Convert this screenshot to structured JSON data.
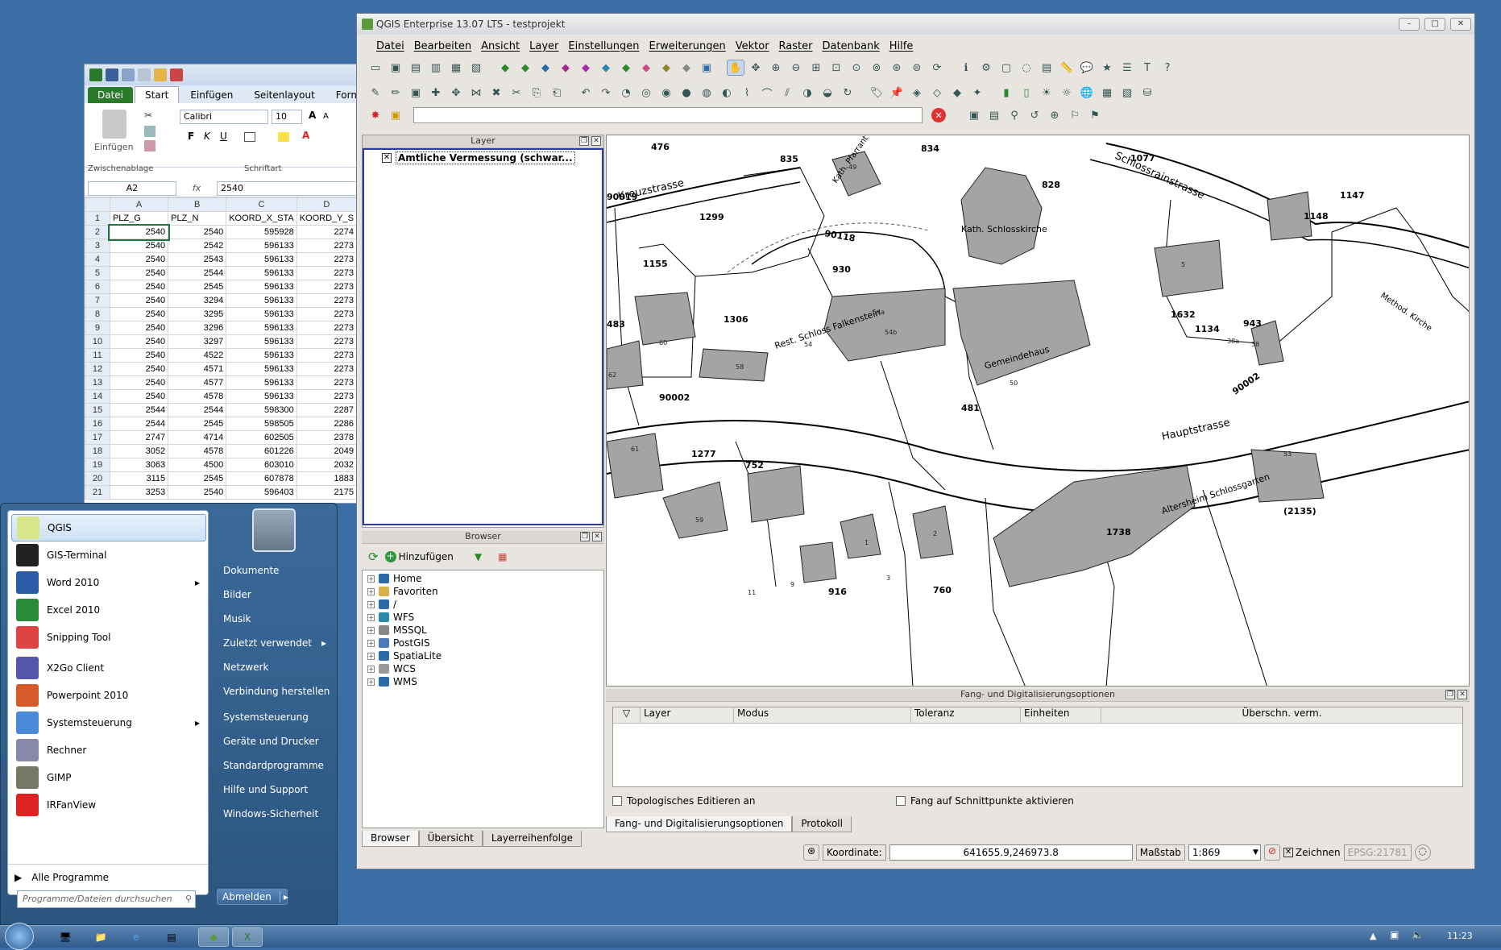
{
  "excel": {
    "tabs": [
      "Datei",
      "Start",
      "Einfügen",
      "Seitenlayout",
      "Formel"
    ],
    "group_labels": [
      "Zwischenablage",
      "Schriftart"
    ],
    "paste_label": "Einfügen",
    "font_name": "Calibri",
    "font_size": "10",
    "name_box": "A2",
    "fx": "fx",
    "formula_value": "2540",
    "col_headers": [
      "",
      "A",
      "B",
      "C",
      "D"
    ],
    "rows": [
      [
        "1",
        "PLZ_G",
        "PLZ_N",
        "KOORD_X_STA",
        "KOORD_Y_S"
      ],
      [
        "2",
        "2540",
        "2540",
        "595928",
        "2274"
      ],
      [
        "3",
        "2540",
        "2542",
        "596133",
        "2273"
      ],
      [
        "4",
        "2540",
        "2543",
        "596133",
        "2273"
      ],
      [
        "5",
        "2540",
        "2544",
        "596133",
        "2273"
      ],
      [
        "6",
        "2540",
        "2545",
        "596133",
        "2273"
      ],
      [
        "7",
        "2540",
        "3294",
        "596133",
        "2273"
      ],
      [
        "8",
        "2540",
        "3295",
        "596133",
        "2273"
      ],
      [
        "9",
        "2540",
        "3296",
        "596133",
        "2273"
      ],
      [
        "10",
        "2540",
        "3297",
        "596133",
        "2273"
      ],
      [
        "11",
        "2540",
        "4522",
        "596133",
        "2273"
      ],
      [
        "12",
        "2540",
        "4571",
        "596133",
        "2273"
      ],
      [
        "13",
        "2540",
        "4577",
        "596133",
        "2273"
      ],
      [
        "14",
        "2540",
        "4578",
        "596133",
        "2273"
      ],
      [
        "15",
        "2544",
        "2544",
        "598300",
        "2287"
      ],
      [
        "16",
        "2544",
        "2545",
        "598505",
        "2286"
      ],
      [
        "17",
        "2747",
        "4714",
        "602505",
        "2378"
      ],
      [
        "18",
        "3052",
        "4578",
        "601226",
        "2049"
      ],
      [
        "19",
        "3063",
        "4500",
        "603010",
        "2032"
      ],
      [
        "20",
        "3115",
        "2545",
        "607878",
        "1883"
      ],
      [
        "21",
        "3253",
        "2540",
        "596403",
        "2175"
      ]
    ],
    "right_edge_values": [
      "175",
      "176",
      "176",
      "175",
      "175",
      "170",
      "170",
      "175",
      "175",
      "175",
      "176",
      "176",
      "175",
      "175",
      "175",
      "175",
      "176",
      "175",
      "170",
      "176",
      "175",
      "175",
      "175",
      "170",
      "175",
      "176"
    ]
  },
  "qgis": {
    "title": "QGIS Enterprise 13.07 LTS - testprojekt",
    "menu": [
      "Datei",
      "Bearbeiten",
      "Ansicht",
      "Layer",
      "Einstellungen",
      "Erweiterungen",
      "Vektor",
      "Raster",
      "Datenbank",
      "Hilfe"
    ],
    "layer_panel_title": "Layer",
    "layer_item": "Amtliche Vermessung (schwar...",
    "browser_panel_title": "Browser",
    "browser_add": "Hinzufügen",
    "browser_items": [
      "Home",
      "Favoriten",
      "/",
      "WFS",
      "MSSQL",
      "PostGIS",
      "SpatiaLite",
      "WCS",
      "WMS"
    ],
    "left_tabs": [
      "Browser",
      "Übersicht",
      "Layerreihenfolge"
    ],
    "snap_panel_title": "Fang- und Digitalisierungsoptionen",
    "snap_columns": [
      "Layer",
      "Modus",
      "Toleranz",
      "Einheiten",
      "Überschn. verm."
    ],
    "topo_label": "Topologisches Editieren an",
    "intersect_label": "Fang auf Schnittpunkte aktivieren",
    "bottom_tabs": [
      "Fang- und Digitalisierungsoptionen",
      "Protokoll"
    ],
    "status": {
      "coord_label": "Koordinate:",
      "coord_value": "641655.9,246973.8",
      "scale_label": "Maßstab",
      "scale_value": "1:869",
      "render_label": "Zeichnen",
      "crs": "EPSG:21781"
    },
    "map_labels": {
      "parcels": [
        "476",
        "835",
        "834",
        "1077",
        "828",
        "1147",
        "1148",
        "1299",
        "930",
        "1155",
        "1306",
        "1632",
        "1134",
        "943",
        "483",
        "90002",
        "481",
        "90002",
        "1277",
        "752",
        "1738",
        "(2135)",
        "916",
        "760",
        "90118",
        "90019"
      ],
      "streets": [
        "Kreuzstrasse",
        "Schlossrainstrasse",
        "Hauptstrasse",
        "Rest. Schloss Falkenstein",
        "Kath. Schlosskirche",
        "Gemeindehaus",
        "Altersheim Schlossgarten",
        "Kath. Pfarrant",
        "Method. Kirche"
      ],
      "house_numbers": [
        "60",
        "58",
        "54",
        "54a",
        "54b",
        "50",
        "62",
        "61",
        "59",
        "9",
        "38",
        "38a",
        "5",
        "53",
        "1",
        "2",
        "3",
        "11",
        "49"
      ]
    }
  },
  "start_menu": {
    "programs": [
      "QGIS",
      "GIS-Terminal",
      "Word 2010",
      "Excel 2010",
      "Snipping Tool",
      "X2Go Client",
      "Powerpoint 2010",
      "Systemsteuerung",
      "Rechner",
      "GIMP",
      "IRFanView"
    ],
    "all_programs": "Alle Programme",
    "search_placeholder": "Programme/Dateien durchsuchen",
    "right_items": [
      "Dokumente",
      "Bilder",
      "Musik",
      "Zuletzt verwendet",
      "Netzwerk",
      "Verbindung herstellen",
      "Systemsteuerung",
      "Geräte und Drucker",
      "Standardprogramme",
      "Hilfe und Support",
      "Windows-Sicherheit"
    ],
    "logoff": "Abmelden"
  },
  "taskbar": {
    "clock": "11:23"
  },
  "colors": {
    "desktop": "#3a6ea5",
    "excel_green": "#2a7a2a",
    "building": "#a4a4a4"
  }
}
